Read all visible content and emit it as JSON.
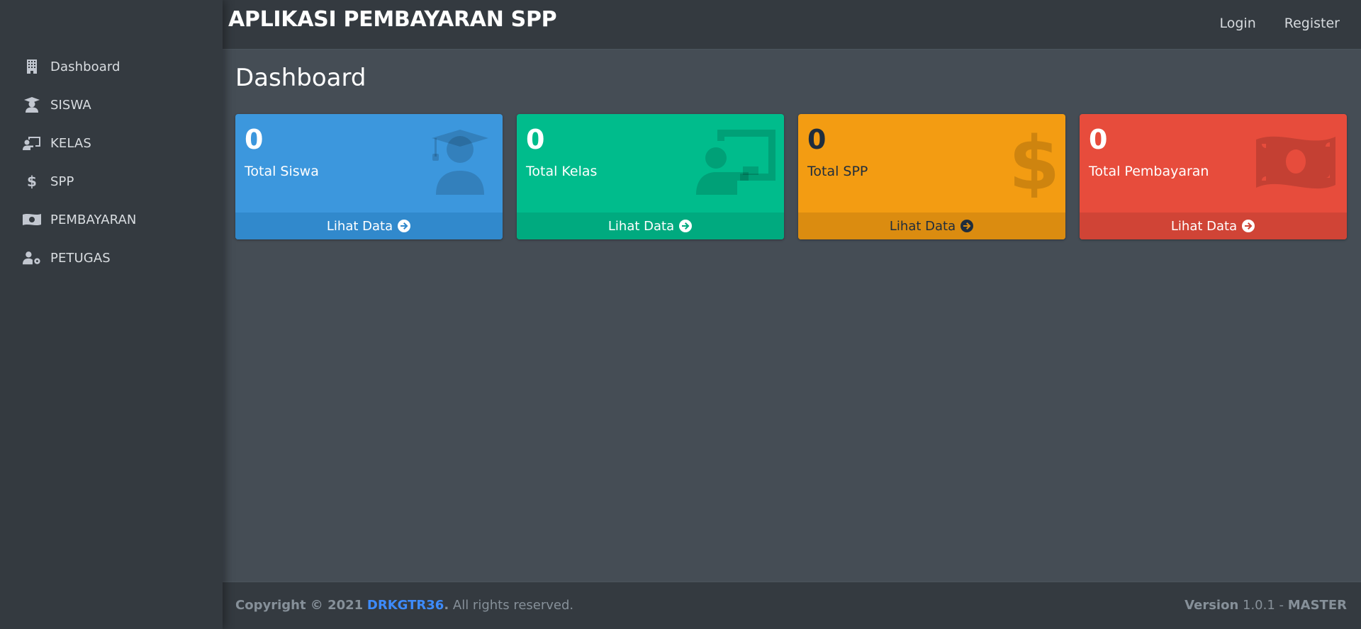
{
  "app": {
    "title": "APLIKASI PEMBAYARAN SPP"
  },
  "topnav": {
    "login": "Login",
    "register": "Register"
  },
  "sidebar": {
    "items": [
      {
        "label": "Dashboard",
        "icon": "building-icon"
      },
      {
        "label": "SISWA",
        "icon": "user-graduate-icon"
      },
      {
        "label": "KELAS",
        "icon": "chalkboard-teacher-icon"
      },
      {
        "label": "SPP",
        "icon": "dollar-sign-icon"
      },
      {
        "label": "PEMBAYARAN",
        "icon": "money-bill-icon"
      },
      {
        "label": "PETUGAS",
        "icon": "user-cog-icon"
      }
    ]
  },
  "main": {
    "page_title": "Dashboard",
    "boxes": [
      {
        "value": "0",
        "label": "Total Siswa",
        "link": "Lihat Data",
        "color": "#3c97dd",
        "icon": "user-graduate-icon"
      },
      {
        "value": "0",
        "label": "Total Kelas",
        "link": "Lihat Data",
        "color": "#00bc8c",
        "icon": "chalkboard-teacher-icon"
      },
      {
        "value": "0",
        "label": "Total SPP",
        "link": "Lihat Data",
        "color": "#f39c12",
        "icon": "dollar-sign-icon"
      },
      {
        "value": "0",
        "label": "Total Pembayaran",
        "link": "Lihat Data",
        "color": "#e74c3c",
        "icon": "money-bill-icon"
      }
    ]
  },
  "footer": {
    "copyright_prefix": "Copyright © 2021",
    "author": "DRKGTR36",
    "dot": ".",
    "rights": " All rights reserved.",
    "version_label": "Version",
    "version_value": " 1.0.1 - ",
    "version_channel": "MASTER"
  }
}
